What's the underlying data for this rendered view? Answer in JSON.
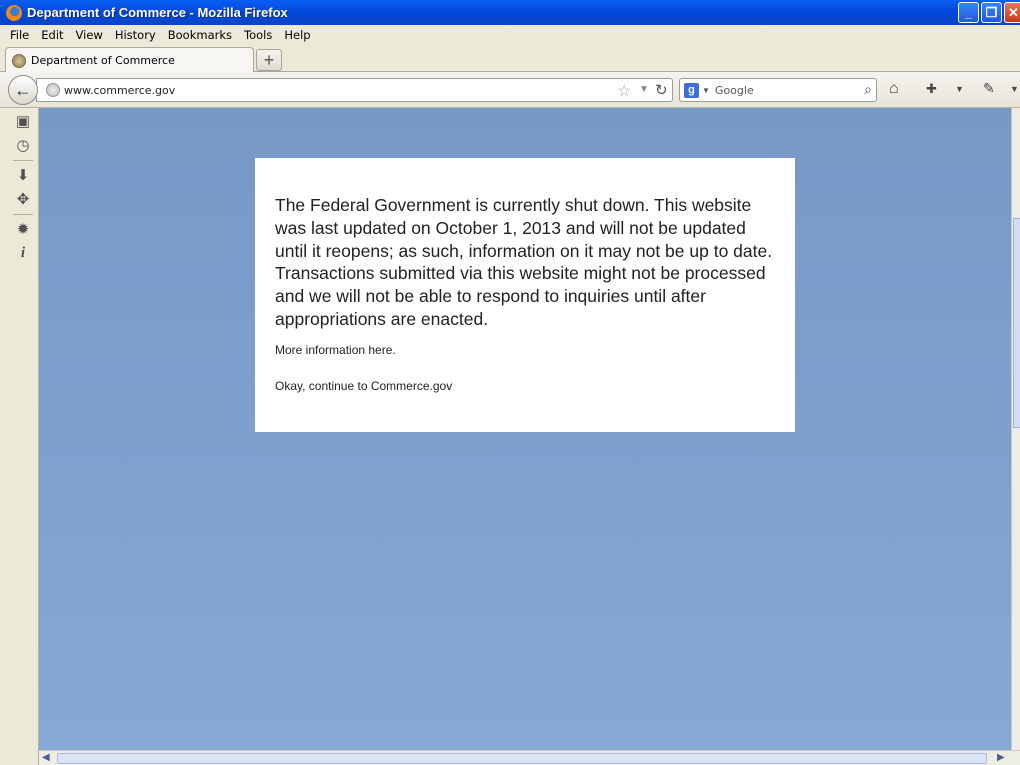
{
  "window": {
    "title": "Department of Commerce - Mozilla Firefox",
    "minimize_glyph": "_",
    "maximize_glyph": "❐",
    "close_glyph": "✕"
  },
  "menubar": {
    "items": [
      {
        "label": "File"
      },
      {
        "label": "Edit"
      },
      {
        "label": "View"
      },
      {
        "label": "History"
      },
      {
        "label": "Bookmarks"
      },
      {
        "label": "Tools"
      },
      {
        "label": "Help"
      }
    ]
  },
  "tabs": [
    {
      "label": "Department of Commerce",
      "active": true
    }
  ],
  "newtab_glyph": "+",
  "navbar": {
    "back_glyph": "←",
    "url": "www.commerce.gov",
    "search_engine": "Google",
    "search_engine_glyph": "g",
    "icons": [
      "bookmark-star-icon",
      "reload-icon",
      "search-icon",
      "home-icon",
      "toolbar-icon",
      "settings-icon"
    ]
  },
  "sidebar": {
    "icons": [
      "bookmarks-icon",
      "history-icon",
      "downloads-icon",
      "addons-icon",
      "settings-gear-icon",
      "info-icon"
    ]
  },
  "dialog": {
    "notice": "The Federal Government is currently shut down. This website was last updated on October 1, 2013 and will not be updated until it reopens; as such, information on it may not be up to date. Transactions submitted via this website might not be processed and we will not be able to respond to inquiries until after appropriations are enacted.",
    "more_info": "More information here.",
    "continue": "Okay, continue to Commerce.gov"
  },
  "colors": {
    "titlebar": "#0346d6",
    "content_bg": "#7d9fcc",
    "dialog_bg": "#ffffff"
  }
}
